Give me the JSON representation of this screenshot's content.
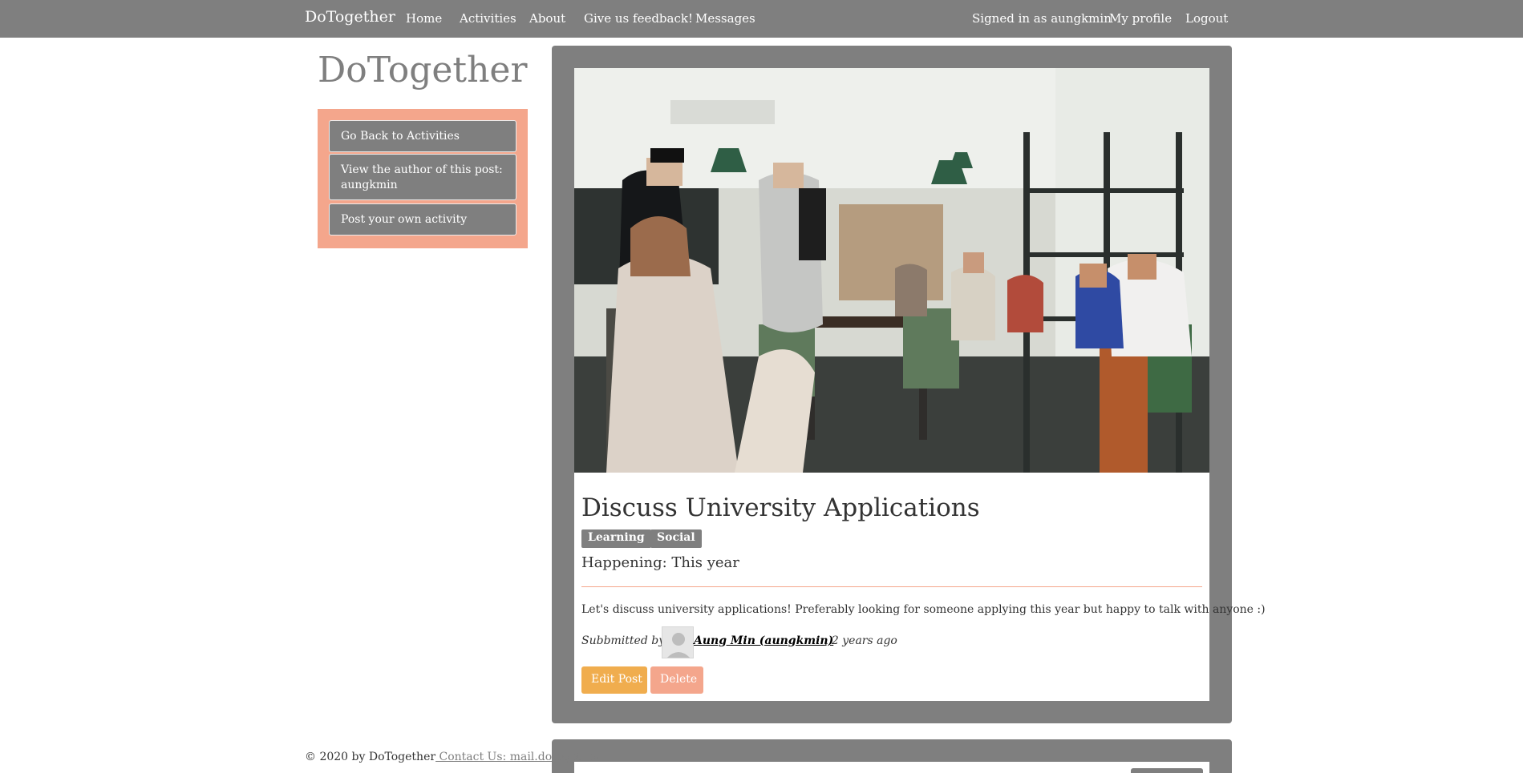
{
  "navbar": {
    "brand": "DoTogether",
    "links": [
      "Home",
      "Activities",
      "About",
      "Give us feedback!",
      "Messages"
    ],
    "signed_in": "Signed in as aungkmin",
    "my_profile": "My profile",
    "logout": "Logout"
  },
  "sidebar": {
    "title": "DoTogether",
    "buttons": [
      "Go Back to Activities",
      "View the author of this post: aungkmin",
      "Post your own activity"
    ]
  },
  "post": {
    "title": "Discuss University Applications",
    "tags": [
      "Learning",
      "Social"
    ],
    "happening": "Happening: This year",
    "body": "Let's discuss university applications! Preferably looking for someone applying this year but happy to talk with anyone :)",
    "submitted_label": "Subbmitted by:",
    "author": "Aung Min (aungkmin)",
    "posted_ago": ", 2 years ago",
    "edit_label": "Edit Post",
    "delete_label": "Delete"
  },
  "footer": {
    "copyright": "© 2020 by DoTogether",
    "contact": " Contact Us: mail.dotogether"
  },
  "colors": {
    "nav_gray": "#7f7f7f",
    "salmon": "#f4a68c",
    "edit_orange": "#f0ad4e"
  }
}
